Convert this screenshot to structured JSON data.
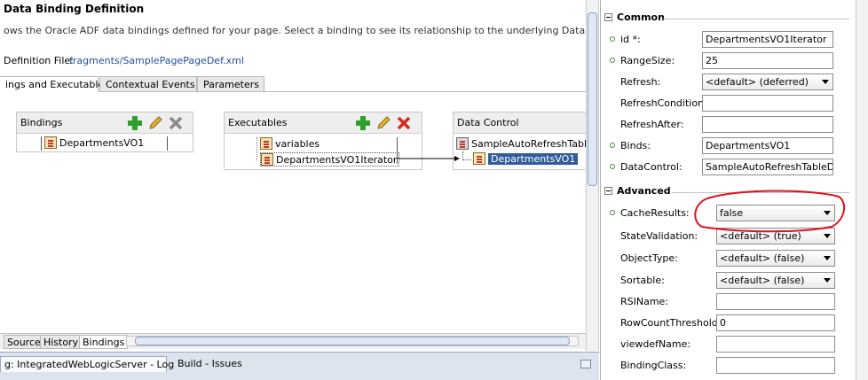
{
  "editor": {
    "title": "Data Binding Definition",
    "description": "ows the Oracle ADF data bindings defined for your page. Select a binding to see its relationship to the underlying Data Control.",
    "page_def_label": "Definition File:",
    "page_def_link": "fragments/SamplePagePageDef.xml",
    "tabs": [
      "ings and Executables",
      "Contextual Events",
      "Parameters"
    ],
    "bindings": {
      "header": "Bindings",
      "items": [
        "DepartmentsVO1"
      ]
    },
    "executables": {
      "header": "Executables",
      "items": [
        "variables",
        "DepartmentsVO1Iterator"
      ]
    },
    "data_control": {
      "header": "Data Control",
      "root": "SampleAutoRefreshTableD",
      "child": "DepartmentsVO1"
    },
    "bottom_tabs": [
      "Source",
      "History",
      "Bindings"
    ]
  },
  "log": {
    "tabs": [
      "g: IntegratedWebLogicServer - Log",
      "Build - Issues"
    ]
  },
  "inspector": {
    "sections": [
      {
        "title": "Common",
        "props": [
          {
            "label": "id *:",
            "value": "DepartmentsVO1Iterator",
            "kind": "input",
            "required": true
          },
          {
            "label": "RangeSize:",
            "value": "25",
            "kind": "input",
            "required": true
          },
          {
            "label": "Refresh:",
            "value": "<default> (deferred)",
            "kind": "select",
            "required": false
          },
          {
            "label": "RefreshCondition:",
            "value": "",
            "kind": "input",
            "required": false
          },
          {
            "label": "RefreshAfter:",
            "value": "",
            "kind": "input",
            "required": false
          },
          {
            "label": "Binds:",
            "value": "DepartmentsVO1",
            "kind": "input",
            "required": true
          },
          {
            "label": "DataControl:",
            "value": "SampleAutoRefreshTableD...",
            "kind": "input",
            "required": true
          }
        ]
      },
      {
        "title": "Advanced",
        "props": [
          {
            "label": "CacheResults:",
            "value": "false",
            "kind": "select",
            "required": true
          },
          {
            "label": "StateValidation:",
            "value": "<default> (true)",
            "kind": "select",
            "required": false
          },
          {
            "label": "ObjectType:",
            "value": "<default> (false)",
            "kind": "select",
            "required": false
          },
          {
            "label": "Sortable:",
            "value": "<default> (false)",
            "kind": "select",
            "required": false
          },
          {
            "label": "RSIName:",
            "value": "",
            "kind": "input",
            "required": false
          },
          {
            "label": "RowCountThreshold:",
            "value": "0",
            "kind": "input",
            "required": false
          },
          {
            "label": "viewdefName:",
            "value": "",
            "kind": "input",
            "required": false
          },
          {
            "label": "BindingClass:",
            "value": "",
            "kind": "input",
            "required": false
          }
        ]
      }
    ]
  },
  "colors": {
    "link": "#1f4fa3",
    "selection": "#2f5c9a",
    "add": "#2e9e2e",
    "delete": "#c0392b",
    "annotation": "#e0101a",
    "required_dot": "#3c8c3c"
  },
  "icons": [
    "add-icon",
    "edit-icon",
    "delete-icon",
    "iterator-icon",
    "binding-icon",
    "data-control-icon",
    "collection-icon"
  ]
}
